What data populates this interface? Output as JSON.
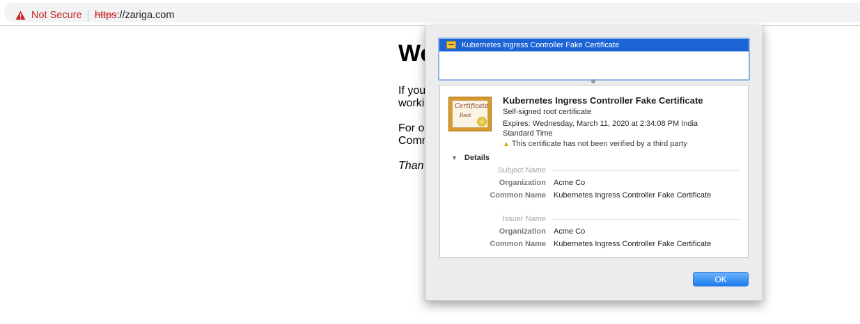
{
  "browser": {
    "security_label": "Not Secure",
    "url_scheme": "https",
    "url_separator": "://",
    "url_host": "zariga.com"
  },
  "background_page": {
    "heading": "We",
    "p1_line1": "If you",
    "p1_line2": "worki",
    "p2_line1": "For o",
    "p2_line2": "Comm",
    "p3": "Than"
  },
  "certificate_dialog": {
    "list_items": [
      {
        "label": "Kubernetes Ingress Controller Fake Certificate",
        "selected": true
      }
    ],
    "icon_text_line1": "Certificate",
    "icon_text_line2": "Root",
    "title": "Kubernetes Ingress Controller Fake Certificate",
    "subtitle": "Self-signed root certificate",
    "expires": "Expires: Wednesday, March 11, 2020 at 2:34:08 PM India Standard Time",
    "warning": "This certificate has not been verified by a third party",
    "details_label": "Details",
    "subject_section": {
      "heading": "Subject Name",
      "rows": [
        {
          "label": "Organization",
          "value": "Acme Co"
        },
        {
          "label": "Common Name",
          "value": "Kubernetes Ingress Controller Fake Certificate"
        }
      ]
    },
    "issuer_section": {
      "heading": "Issuer Name",
      "rows": [
        {
          "label": "Organization",
          "value": "Acme Co"
        },
        {
          "label": "Common Name",
          "value": "Kubernetes Ingress Controller Fake Certificate"
        }
      ]
    },
    "ok_label": "OK"
  },
  "icons": {
    "security_warning": "warning-triangle-icon",
    "certificate": "certificate-icon",
    "details_disclosure": "disclosure-triangle-icon"
  },
  "colors": {
    "danger": "#c5221f",
    "selection": "#1a64d6",
    "button": "#1e7cf0"
  }
}
